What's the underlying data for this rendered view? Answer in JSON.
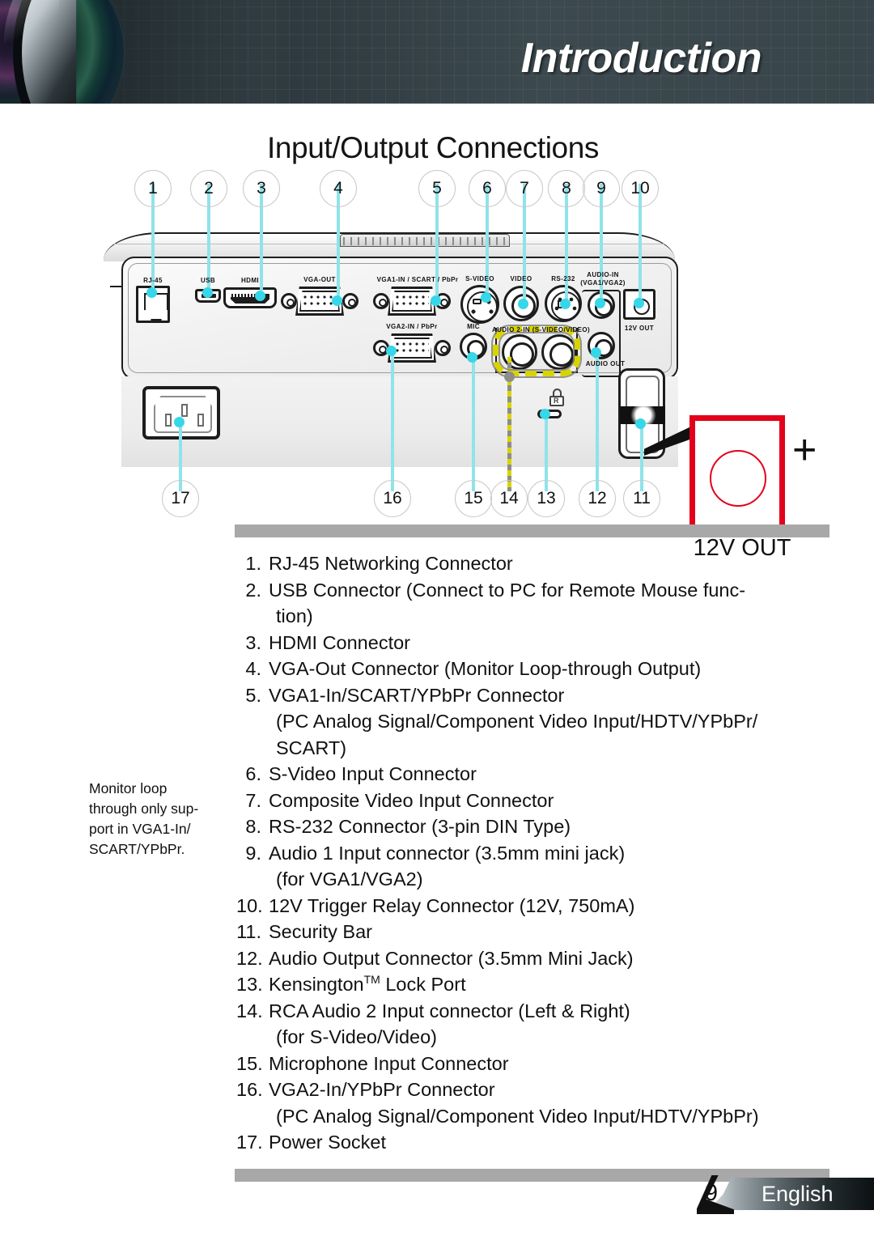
{
  "header": {
    "title": "Introduction",
    "lens_icon": "projector-lens-photo"
  },
  "section": {
    "title": "Input/Output Connections"
  },
  "diagram": {
    "top_callouts": [
      "1",
      "2",
      "3",
      "4",
      "5",
      "6",
      "7",
      "8",
      "9",
      "10"
    ],
    "bottom_callouts": [
      "17",
      "16",
      "15",
      "14",
      "13",
      "12",
      "11"
    ],
    "port_labels": [
      "RJ-45",
      "USB",
      "HDMI",
      "VGA-OUT",
      "VGA1-IN / SCART / PbPr",
      "S-VIDEO",
      "VIDEO",
      "RS-232",
      "AUDIO-IN",
      "(VGA1/VGA2)",
      "12V OUT",
      "VGA2-IN / PbPr",
      "MIC",
      "AUDIO 2-IN (S-VIDEO/VIDEO)",
      "AUDIO OUT"
    ],
    "labels": {
      "rj45": "RJ-45",
      "usb": "USB",
      "hdmi": "HDMI",
      "vga_out": "VGA-OUT",
      "vga1_in": "VGA1-IN / SCART / PbPr",
      "svideo": "S-VIDEO",
      "video": "VIDEO",
      "rs232": "RS-232",
      "audio_in": "AUDIO-IN",
      "audio_in_sub": "(VGA1/VGA2)",
      "trigger_12v": "12V OUT",
      "vga2_in": "VGA2-IN / PbPr",
      "mic": "MIC",
      "audio2_in": "AUDIO 2-IN (S-VIDEO/VIDEO)",
      "audio_out": "AUDIO OUT"
    },
    "callout_box": {
      "label": "12V OUT",
      "plus_symbol": "+",
      "border_color": "#e3001b",
      "circle_color": "#e3001b"
    },
    "leader_color": "#36d7e8",
    "dashed_leader_colors": [
      "#d8d400",
      "#8d8d8d"
    ]
  },
  "side_note": {
    "lines": [
      "Monitor loop",
      "through only sup-",
      "port in VGA1-In/",
      "SCART/YPbPr."
    ]
  },
  "list": [
    {
      "num": "1.",
      "text": "RJ-45 Networking Connector",
      "cont": []
    },
    {
      "num": "2.",
      "text": "USB Connector (Connect to PC for Remote Mouse func-",
      "cont": [
        "tion)"
      ]
    },
    {
      "num": "3.",
      "text": "HDMI Connector",
      "cont": []
    },
    {
      "num": "4.",
      "text": "VGA-Out Connector (Monitor Loop-through Output)",
      "cont": []
    },
    {
      "num": "5.",
      "text": "VGA1-In/SCART/YPbPr Connector",
      "cont": [
        "(PC Analog Signal/Component Video Input/HDTV/YPbPr/",
        "SCART)"
      ]
    },
    {
      "num": "6.",
      "text": "S-Video Input Connector",
      "cont": []
    },
    {
      "num": "7.",
      "text": "Composite Video Input Connector",
      "cont": []
    },
    {
      "num": "8.",
      "text": "RS-232 Connector (3-pin DIN Type)",
      "cont": []
    },
    {
      "num": "9.",
      "text": "Audio 1 Input connector (3.5mm mini jack)",
      "cont": [
        "(for VGA1/VGA2)"
      ]
    },
    {
      "num": "10.",
      "text": "12V Trigger Relay Connector (12V, 750mA)",
      "cont": []
    },
    {
      "num": "11.",
      "text": "Security Bar",
      "cont": []
    },
    {
      "num": "12.",
      "text": "Audio Output Connector (3.5mm Mini Jack)",
      "cont": []
    },
    {
      "num": "13.",
      "text": "Kensington Lock Port",
      "text_prefix": "Kensington",
      "text_suffix": " Lock Port",
      "superscript": "TM",
      "cont": []
    },
    {
      "num": "14.",
      "text": "RCA Audio 2 Input connector (Left & Right)",
      "cont": [
        "(for S-Video/Video)"
      ]
    },
    {
      "num": "15.",
      "text": "Microphone Input Connector",
      "cont": []
    },
    {
      "num": "16.",
      "text": "VGA2-In/YPbPr Connector",
      "cont": [
        "(PC Analog Signal/Component Video Input/HDTV/YPbPr)"
      ]
    },
    {
      "num": "17.",
      "text": "Power Socket",
      "cont": []
    }
  ],
  "footer": {
    "page_number": "9",
    "language": "English"
  }
}
